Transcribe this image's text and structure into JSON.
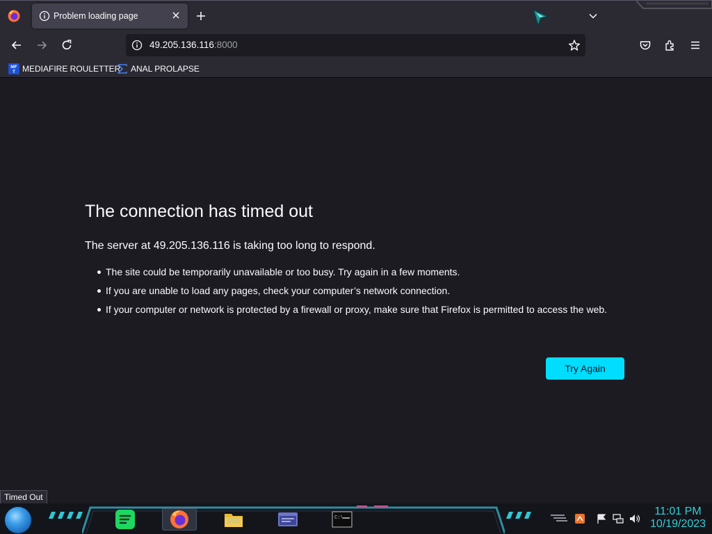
{
  "browser": {
    "tab": {
      "title": "Problem loading page"
    },
    "url": {
      "host": "49.205.136.116",
      "port": ":8000"
    }
  },
  "bookmarks": [
    {
      "label": "MEDIAFIRE ROULETTER",
      "icon": "mediafire-icon"
    },
    {
      "label": "ANAL PROLAPSE",
      "icon": "sigma-icon"
    }
  ],
  "error": {
    "title": "The connection has timed out",
    "subtitle": "The server at 49.205.136.116 is taking too long to respond.",
    "bullets": [
      "The site could be temporarily unavailable or too busy. Try again in a few moments.",
      "If you are unable to load any pages, check your computer’s network connection.",
      "If your computer or network is protected by a firewall or proxy, make sure that Firefox is permitted to access the web."
    ],
    "button": "Try Again"
  },
  "status": {
    "text": "Timed Out"
  },
  "taskbar": {
    "apps": [
      "spotify-icon",
      "firefox-icon",
      "file-explorer-icon",
      "window-app-icon",
      "command-prompt-icon"
    ],
    "tray": [
      "speed-icon",
      "flag-icon",
      "network-icon",
      "volume-icon"
    ],
    "time": "11:01 PM",
    "date": "10/19/2023"
  },
  "colors": {
    "accent": "#00ddff",
    "clock": "#32d0d8",
    "page_bg": "#1c1b22",
    "chrome_bg": "#2b2a33"
  }
}
